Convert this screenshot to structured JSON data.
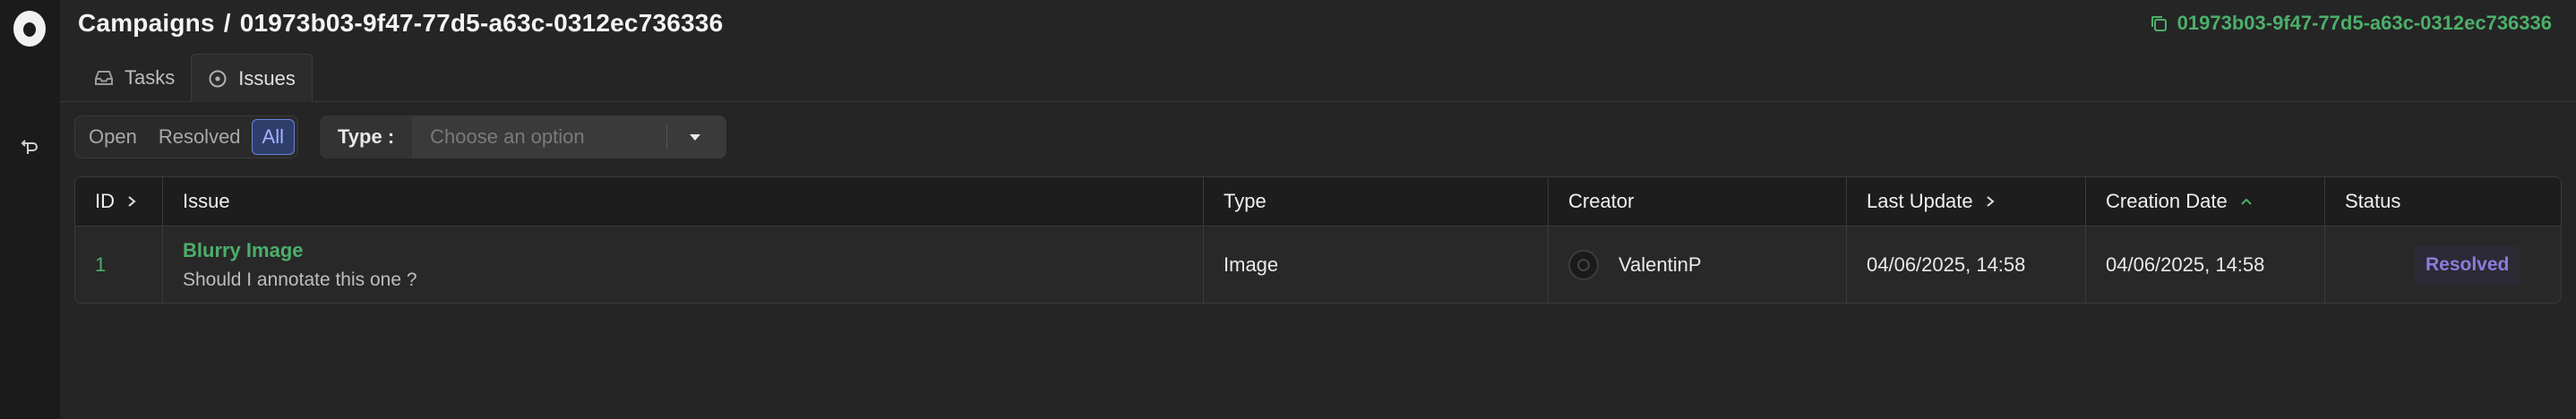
{
  "header": {
    "section": "Campaigns",
    "separator": "/",
    "campaign_id": "01973b03-9f47-77d5-a63c-0312ec736336",
    "copy_id_label": "01973b03-9f47-77d5-a63c-0312ec736336"
  },
  "tabs": [
    {
      "label": "Tasks",
      "icon": "inbox-icon",
      "active": false
    },
    {
      "label": "Issues",
      "icon": "circle-dot-icon",
      "active": true
    }
  ],
  "filters": {
    "status_options": [
      "Open",
      "Resolved",
      "All"
    ],
    "status_selected": "All",
    "type_label": "Type :",
    "type_placeholder": "Choose an option"
  },
  "table": {
    "columns": [
      "ID",
      "Issue",
      "Type",
      "Creator",
      "Last Update",
      "Creation Date",
      "Status"
    ],
    "rows": [
      {
        "id": "1",
        "issue_title": "Blurry Image",
        "issue_description": "Should I annotate this one ?",
        "type": "Image",
        "creator": "ValentinP",
        "last_update": "04/06/2025, 14:58",
        "creation_date": "04/06/2025, 14:58",
        "status": "Resolved"
      }
    ]
  },
  "colors": {
    "accent_green": "#4caf6a",
    "selected_blue": "#6a84d8",
    "status_resolved": "#8f7bdc",
    "background": "#252525"
  }
}
